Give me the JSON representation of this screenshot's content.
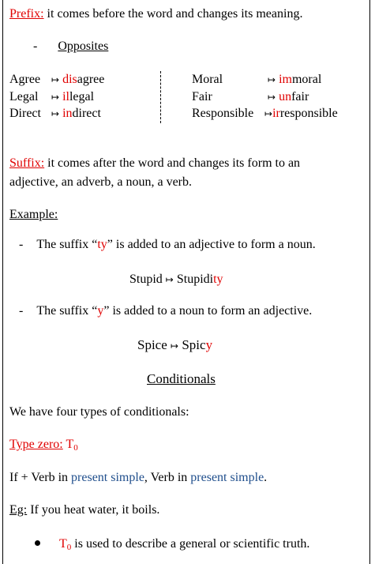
{
  "prefix": {
    "heading": "Prefix:",
    "text": "it comes before the word and changes its meaning.",
    "subheading_dash": "-",
    "subheading": "Opposites",
    "left": [
      {
        "word": "Agree",
        "arrow": "↦",
        "red": "dis",
        "rest": "agree"
      },
      {
        "word": "Legal",
        "arrow": "↦",
        "red": "il",
        "rest": "legal"
      },
      {
        "word": "Direct",
        "arrow": "↦",
        "red": "in",
        "rest": "direct"
      }
    ],
    "right": [
      {
        "word": "Moral",
        "arrow": "↦",
        "red": "im",
        "rest": "moral"
      },
      {
        "word": "Fair",
        "arrow": "↦",
        "red": "un",
        "rest": "fair"
      },
      {
        "word": "Responsible",
        "arrow": "↦",
        "red": "ir",
        "rest": "responsible"
      }
    ]
  },
  "suffix": {
    "heading": "Suffix:",
    "line1": "it comes after the word and changes its form to an",
    "line2": "adjective, an adverb, a noun, a verb.",
    "example_label": "Example:",
    "item1": {
      "dash": "-",
      "pre": "The suffix “",
      "suffix": "ty",
      "post": "” is added to an adjective to form a noun."
    },
    "ex1": {
      "word": "Stupid",
      "arrow": "↦",
      "base": "Stupidi",
      "red": "ty"
    },
    "item2": {
      "dash": "-",
      "pre": "The suffix “",
      "suffix": "y",
      "post": "” is added to a noun to form an adjective."
    },
    "ex2": {
      "word": "Spice",
      "arrow": "↦",
      "base": "Spic",
      "red": "y"
    }
  },
  "conditionals": {
    "title": "Conditionals",
    "intro": "We have four types of conditionals:",
    "type_zero_label": "Type zero:",
    "type_zero_symbol": "T",
    "type_zero_sub": "0",
    "formula": {
      "a": "If + Verb in ",
      "b": "present simple",
      "c": ", Verb in ",
      "d": "present simple",
      "e": "."
    },
    "eg_label": "Eg:",
    "eg_text": "If you heat water, it boils.",
    "bullet": {
      "symbol": "T",
      "sub": "0",
      "text": "is used to describe a general or scientific truth."
    }
  },
  "colors": {
    "accent_red": "#e00000",
    "accent_blue": "#1f4e8c"
  }
}
